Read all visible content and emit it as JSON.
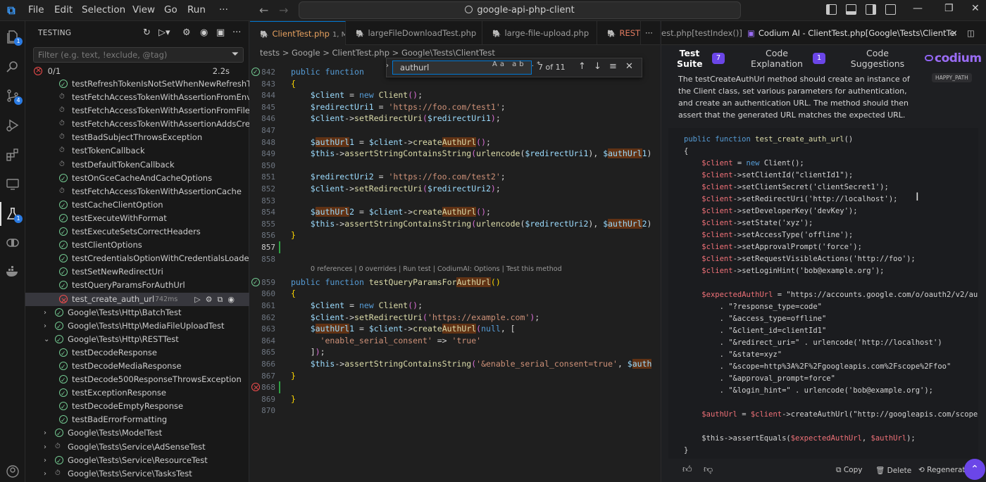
{
  "titlebar": {
    "menus": [
      "File",
      "Edit",
      "Selection",
      "View",
      "Go",
      "Run",
      "···"
    ],
    "command_center": "google-api-php-client"
  },
  "activity_badges": {
    "explorer": "1",
    "source_control": "4",
    "testing": "1"
  },
  "sidebar": {
    "title": "TESTING",
    "filter_placeholder": "Filter (e.g. text, !exclude, @tag)",
    "summary_count": "0/1",
    "summary_time": "2.2s",
    "tree": [
      {
        "label": "testRefreshTokenIsNotSetWhenNewRefreshToke...",
        "status": "pass",
        "depth": 2
      },
      {
        "label": "testFetchAccessTokenWithAssertionFromEnv",
        "status": "pending",
        "depth": 2
      },
      {
        "label": "testFetchAccessTokenWithAssertionFromFile",
        "status": "pending",
        "depth": 2
      },
      {
        "label": "testFetchAccessTokenWithAssertionAddsCreated",
        "status": "pending",
        "depth": 2
      },
      {
        "label": "testBadSubjectThrowsException",
        "status": "pending",
        "depth": 2
      },
      {
        "label": "testTokenCallback",
        "status": "pending",
        "depth": 2
      },
      {
        "label": "testDefaultTokenCallback",
        "status": "pending",
        "depth": 2
      },
      {
        "label": "testOnGceCacheAndCacheOptions",
        "status": "pass",
        "depth": 2
      },
      {
        "label": "testFetchAccessTokenWithAssertionCache",
        "status": "pending",
        "depth": 2
      },
      {
        "label": "testCacheClientOption",
        "status": "pass",
        "depth": 2
      },
      {
        "label": "testExecuteWithFormat",
        "status": "pass",
        "depth": 2
      },
      {
        "label": "testExecuteSetsCorrectHeaders",
        "status": "pass",
        "depth": 2
      },
      {
        "label": "testClientOptions",
        "status": "pass",
        "depth": 2
      },
      {
        "label": "testCredentialsOptionWithCredentialsLoader",
        "status": "pass",
        "depth": 2
      },
      {
        "label": "testSetNewRedirectUri",
        "status": "pass",
        "depth": 2
      },
      {
        "label": "testQueryParamsForAuthUrl",
        "status": "pass",
        "depth": 2
      },
      {
        "label": "test_create_auth_url",
        "status": "fail",
        "depth": 2,
        "duration": "742ms",
        "selected": true
      },
      {
        "label": "Google\\Tests\\Http\\BatchTest",
        "status": "pass",
        "depth": 1,
        "chevron": "right"
      },
      {
        "label": "Google\\Tests\\Http\\MediaFileUploadTest",
        "status": "pass",
        "depth": 1,
        "chevron": "right"
      },
      {
        "label": "Google\\Tests\\Http\\RESTTest",
        "status": "pass",
        "depth": 1,
        "chevron": "down"
      },
      {
        "label": "testDecodeResponse",
        "status": "pass",
        "depth": 2
      },
      {
        "label": "testDecodeMediaResponse",
        "status": "pass",
        "depth": 2
      },
      {
        "label": "testDecode500ResponseThrowsException",
        "status": "pass",
        "depth": 2
      },
      {
        "label": "testExceptionResponse",
        "status": "pass",
        "depth": 2
      },
      {
        "label": "testDecodeEmptyResponse",
        "status": "pass",
        "depth": 2
      },
      {
        "label": "testBadErrorFormatting",
        "status": "pass",
        "depth": 2
      },
      {
        "label": "Google\\Tests\\ModelTest",
        "status": "pass",
        "depth": 1,
        "chevron": "right"
      },
      {
        "label": "Google\\Tests\\Service\\AdSenseTest",
        "status": "pending",
        "depth": 1,
        "chevron": "right"
      },
      {
        "label": "Google\\Tests\\Service\\ResourceTest",
        "status": "pass",
        "depth": 1,
        "chevron": "right"
      },
      {
        "label": "Google\\Tests\\Service\\TasksTest",
        "status": "pending",
        "depth": 1,
        "chevron": "right"
      }
    ]
  },
  "editor": {
    "tabs": [
      {
        "label": "ClientTest.php",
        "suffix": "1, M",
        "active": true
      },
      {
        "label": "largeFileDownloadTest.php",
        "suffix": ""
      },
      {
        "label": "large-file-upload.php",
        "suffix": ""
      },
      {
        "label": "REST",
        "suffix": ""
      },
      {
        "label": "est.php[testIndex()]",
        "suffix": ""
      }
    ],
    "breadcrumbs": "tests > Google > ClientTest.php > Google\\Tests\\ClientTest",
    "find": {
      "query": "authurl",
      "count": "7 of 11",
      "options": "Aa ab .*"
    },
    "lens1": "0 references | 0 overrides",
    "lens2": "0 references | 0 overrides | Run test | CodiumAI: Options | Test this method",
    "line_numbers": [
      "842",
      "843",
      "844",
      "845",
      "846",
      "847",
      "848",
      "849",
      "850",
      "851",
      "852",
      "853",
      "854",
      "855",
      "856",
      "857",
      "858",
      "859",
      "860",
      "861",
      "862",
      "863",
      "864",
      "865",
      "866",
      "867",
      "868",
      "869",
      "870"
    ],
    "current_line": "857"
  },
  "codium": {
    "title": "Codium AI - ClientTest.php[Google\\Tests\\ClientTest]",
    "subtabs": [
      {
        "label": "Test Suite",
        "badge": "7",
        "active": true
      },
      {
        "label": "Code Explanation",
        "badge": "1"
      },
      {
        "label": "Code Suggestions",
        "badge": ""
      }
    ],
    "brand": "codium",
    "tag": "HAPPY_PATH",
    "description": "The testCreateAuthUrl method should create an instance of the Client class, set various parameters for authentication, and create an authentication URL. The method should then assert that the generated URL matches the expected URL.",
    "footer": {
      "copy": "Copy",
      "delete": "Delete",
      "regenerate": "Regenerate"
    }
  }
}
